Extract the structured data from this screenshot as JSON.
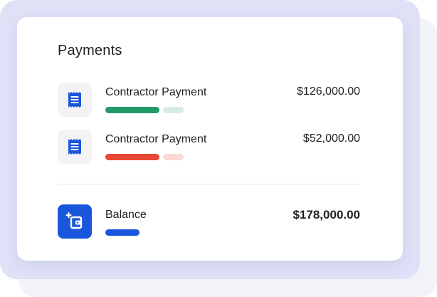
{
  "colors": {
    "frame": "#dfe1f7",
    "card": "#ffffff",
    "icon_tile": "#f3f3f5",
    "brand_blue": "#1a56db",
    "green": "#24996a",
    "green_light": "#d4ede3",
    "red": "#e74733",
    "red_light": "#fbd9d4",
    "text": "#1e1f24"
  },
  "card": {
    "title": "Payments"
  },
  "payments": [
    {
      "icon": "receipt-icon",
      "label": "Contractor Payment",
      "amount": "$126,000.00",
      "bar_primary_color": "#24996a",
      "bar_secondary_color": "#d4ede3"
    },
    {
      "icon": "receipt-icon",
      "label": "Contractor Payment",
      "amount": "$52,000.00",
      "bar_primary_color": "#e74733",
      "bar_secondary_color": "#fbd9d4"
    }
  ],
  "balance": {
    "icon": "wallet-add-icon",
    "label": "Balance",
    "amount": "$178,000.00",
    "bar_color": "#1a56db"
  }
}
